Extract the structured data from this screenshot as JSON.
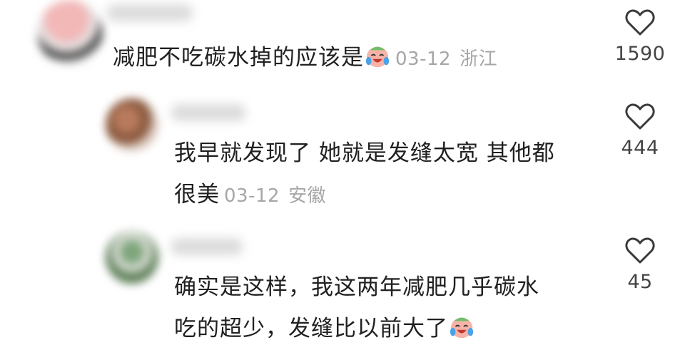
{
  "comments": [
    {
      "text": "减肥不吃碳水掉的应该是",
      "emoji": "crying-laughing-face-icon",
      "date": "03-12",
      "location": "浙江",
      "likes": "1590"
    },
    {
      "text_line1": "我早就发现了 她就是发缝太宽 其他都",
      "text_line2": "很美",
      "date": "03-12",
      "location": "安徽",
      "likes": "444"
    },
    {
      "text_line1": "确实是这样，我这两年减肥几乎碳水",
      "text_line2": "吃的超少，发缝比以前大了",
      "emoji": "crying-laughing-face-icon",
      "likes": "45"
    }
  ]
}
